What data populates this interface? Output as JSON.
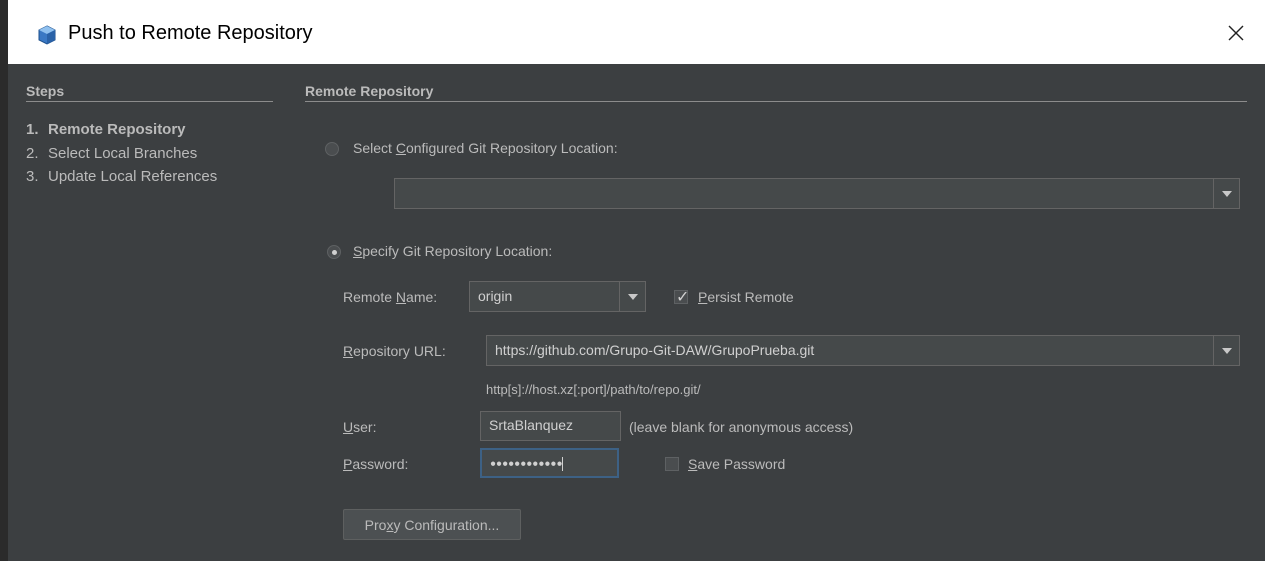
{
  "window": {
    "title": "Push to Remote Repository",
    "app_icon": "cube-icon",
    "close_icon": "close-icon"
  },
  "steps": {
    "header": "Steps",
    "items": [
      {
        "num": "1.",
        "label": "Remote Repository",
        "active": true
      },
      {
        "num": "2.",
        "label": "Select Local Branches",
        "active": false
      },
      {
        "num": "3.",
        "label": "Update Local References",
        "active": false
      }
    ]
  },
  "panel": {
    "header": "Remote Repository",
    "configured_option": {
      "pre": "Select ",
      "mnemonic": "C",
      "post": "onfigured Git Repository Location:",
      "selected": false,
      "combo_value": ""
    },
    "specify_option": {
      "pre": "",
      "mnemonic": "S",
      "post": "pecify Git Repository Location:",
      "selected": true
    },
    "remote_name": {
      "label_pre": "Remote ",
      "label_mnemonic": "N",
      "label_post": "ame:",
      "value": "origin"
    },
    "persist_remote": {
      "mnemonic": "P",
      "post": "ersist Remote",
      "checked": true
    },
    "repository_url": {
      "label_mnemonic": "R",
      "label_post": "epository URL:",
      "value": "https://github.com/Grupo-Git-DAW/GrupoPrueba.git",
      "hint": "http[s]://host.xz[:port]/path/to/repo.git/"
    },
    "user": {
      "label_mnemonic": "U",
      "label_post": "ser:",
      "value": "SrtaBlanquez",
      "hint": "(leave blank for anonymous access)"
    },
    "password": {
      "label_mnemonic": "P",
      "label_post": "assword:",
      "value": "●●●●●●●●●●●●"
    },
    "save_password": {
      "mnemonic": "S",
      "post": "ave Password",
      "checked": false
    },
    "proxy_button": {
      "pre": "Pro",
      "mnemonic": "x",
      "post": "y Configuration..."
    }
  },
  "colors": {
    "background": "#3c3f41",
    "text": "#bbbbbb",
    "field": "#45494a",
    "focus": "#3d6185"
  }
}
